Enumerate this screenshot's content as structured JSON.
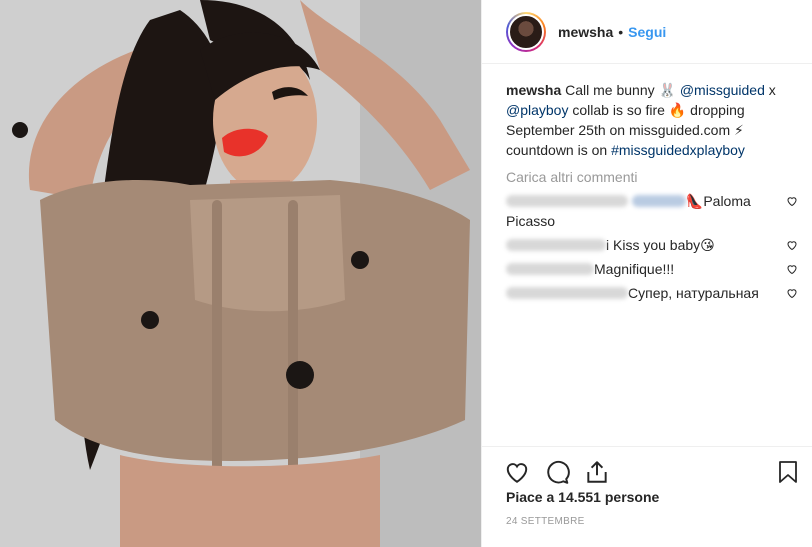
{
  "post": {
    "username": "mewsha",
    "separator": "•",
    "follow_label": "Segui",
    "caption": {
      "username": "mewsha",
      "text_1": " Call me bunny 🐰 ",
      "mention_1": "@missguided",
      "text_2": " x ",
      "mention_2": "@playboy",
      "text_3": " collab is so fire 🔥 dropping September 25th on missguided.com ⚡ countdown is on ",
      "hashtag": "#missguidedxplayboy"
    },
    "load_more_label": "Carica altri commenti",
    "comments": [
      {
        "text": "👠Paloma Picasso"
      },
      {
        "text": "i Kiss you baby😘"
      },
      {
        "text": "Magnifique!!!"
      },
      {
        "text": "Супер, натуральная"
      }
    ],
    "likes": "Piace a 14.551 persone",
    "date": "24 settembre"
  },
  "icons": {
    "like": "heart-icon",
    "comment": "comment-icon",
    "share": "share-icon",
    "save": "bookmark-icon",
    "comment_like": "heart-icon"
  },
  "colors": {
    "link": "#003569",
    "follow": "#3897f0",
    "muted": "#999999",
    "text": "#262626",
    "lips": "#e8322a"
  }
}
